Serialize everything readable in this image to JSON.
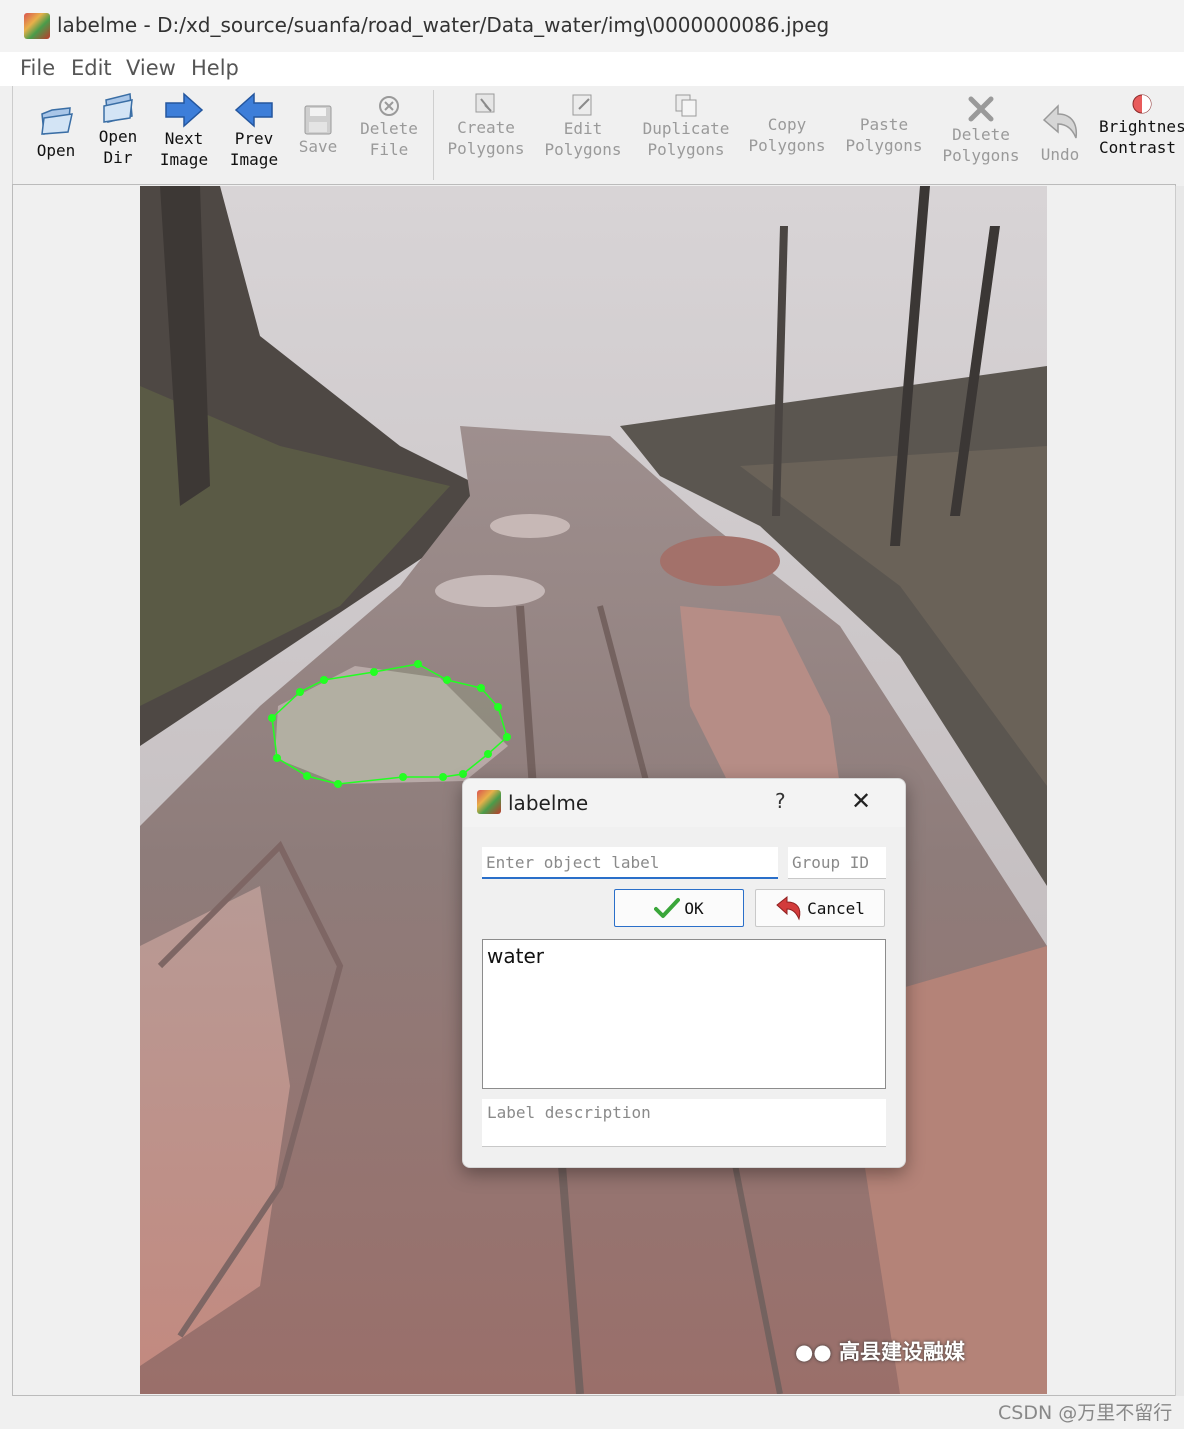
{
  "window": {
    "title": "labelme - D:/xd_source/suanfa/road_water/Data_water/img\\0000000086.jpeg"
  },
  "menu": [
    "File",
    "Edit",
    "View",
    "Help"
  ],
  "toolbar": {
    "open": "Open",
    "open_dir": "Open\nDir",
    "next_image": "Next\nImage",
    "prev_image": "Prev\nImage",
    "save": "Save",
    "delete_file": "Delete\nFile",
    "create_polygons": "Create\nPolygons",
    "edit_polygons": "Edit\nPolygons",
    "duplicate_polygons": "Duplicate\nPolygons",
    "copy_polygons": "Copy\nPolygons",
    "paste_polygons": "Paste\nPolygons",
    "delete_polygons": "Delete\nPolygons",
    "undo": "Undo",
    "brightness_contrast": "Brightness\nContrast"
  },
  "image": {
    "caption": "高县建设融媒",
    "annotation_color": "#22ff22"
  },
  "dialog": {
    "title": "labelme",
    "help": "?",
    "close": "✕",
    "label_placeholder": "Enter object label",
    "group_id_placeholder": "Group ID",
    "ok": "OK",
    "cancel": "Cancel",
    "labels": [
      "water"
    ],
    "description_placeholder": "Label description"
  },
  "watermark": "CSDN @万里不留行",
  "colors": {
    "accent": "#2a6fc9",
    "ok_check": "#3aa63a",
    "cancel_arrow": "#d23b3b",
    "arrow_blue": "#3d7ed9"
  }
}
